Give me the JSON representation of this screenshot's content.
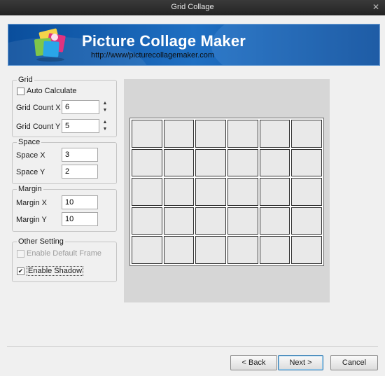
{
  "window": {
    "title": "Grid Collage"
  },
  "banner": {
    "app_name": "Picture Collage Maker",
    "url": "http://www/picturecollagemaker.com"
  },
  "grid": {
    "legend": "Grid",
    "auto_calculate": {
      "label": "Auto Calculate",
      "checked": false
    },
    "count_x": {
      "label": "Grid Count X",
      "value": "6"
    },
    "count_y": {
      "label": "Grid Count Y",
      "value": "5"
    }
  },
  "space": {
    "legend": "Space",
    "x": {
      "label": "Space X",
      "value": "3"
    },
    "y": {
      "label": "Space Y",
      "value": "2"
    }
  },
  "margin": {
    "legend": "Margin",
    "x": {
      "label": "Margin X",
      "value": "10"
    },
    "y": {
      "label": "Margin Y",
      "value": "10"
    }
  },
  "other": {
    "legend": "Other Setting",
    "default_frame": {
      "label": "Enable Default Frame",
      "checked": false,
      "enabled": false
    },
    "shadow": {
      "label": "Enable Shadow",
      "checked": true
    }
  },
  "preview": {
    "columns": 6,
    "rows": 5
  },
  "buttons": {
    "back": "< Back",
    "next": "Next >",
    "cancel": "Cancel"
  },
  "icons": {
    "close": "close-icon",
    "spin_up": "spin-up-icon",
    "spin_down": "spin-down-icon",
    "check": "check-icon"
  }
}
